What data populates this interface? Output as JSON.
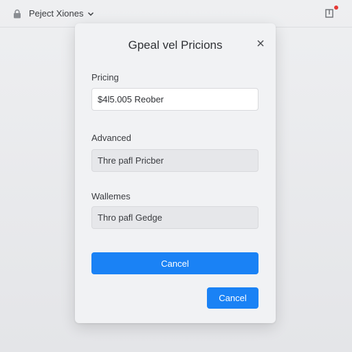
{
  "header": {
    "project_name": "Peject Xiones"
  },
  "colors": {
    "accent": "#1a82f5",
    "notification_dot": "#e53935",
    "icon": "#6b6e73"
  },
  "icons": {
    "lock": "lock-icon",
    "chevron": "chevron-down-icon",
    "notification": "notification-icon",
    "close": "close-icon"
  },
  "modal": {
    "title": "Gpeal vel Pricions",
    "fields": [
      {
        "label": "Pricing",
        "value": "$4l5.005 Reober"
      },
      {
        "label": "Advanced",
        "value": "Thre pafl Pricber"
      },
      {
        "label": "Wallemes",
        "value": "Thro pafl Gedge"
      }
    ],
    "primary_button_label": "Cancel",
    "secondary_button_label": "Cancel"
  }
}
